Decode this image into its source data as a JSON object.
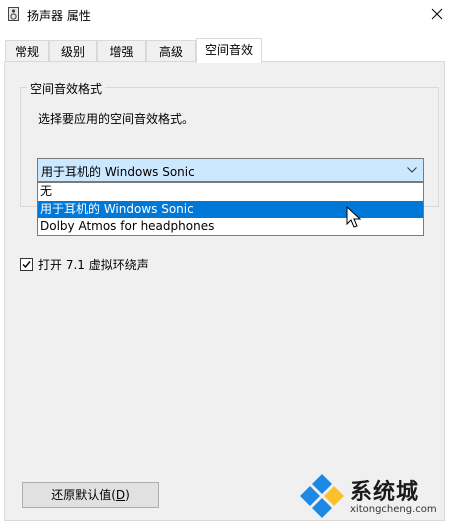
{
  "window": {
    "title": "扬声器 属性"
  },
  "tabs": [
    {
      "label": "常规",
      "active": false
    },
    {
      "label": "级别",
      "active": false
    },
    {
      "label": "增强",
      "active": false
    },
    {
      "label": "高级",
      "active": false
    },
    {
      "label": "空间音效",
      "active": true
    }
  ],
  "spatial": {
    "group_title": "空间音效格式",
    "description": "选择要应用的空间音效格式。",
    "selected": "用于耳机的 Windows Sonic",
    "options": [
      "无",
      "用于耳机的 Windows Sonic",
      "Dolby Atmos for headphones"
    ]
  },
  "virtual_surround": {
    "label": "打开 7.1 虚拟环绕声",
    "checked": true
  },
  "restore_button": {
    "label_prefix": "还原默认值(",
    "accel": "D",
    "label_suffix": ")"
  },
  "watermark": {
    "brand": "系统城",
    "url": "xitongcheng.com"
  },
  "colors": {
    "accent": "#0078d7",
    "combo_bg": "#cce8ff",
    "panel_bg": "#f0f0f0"
  }
}
